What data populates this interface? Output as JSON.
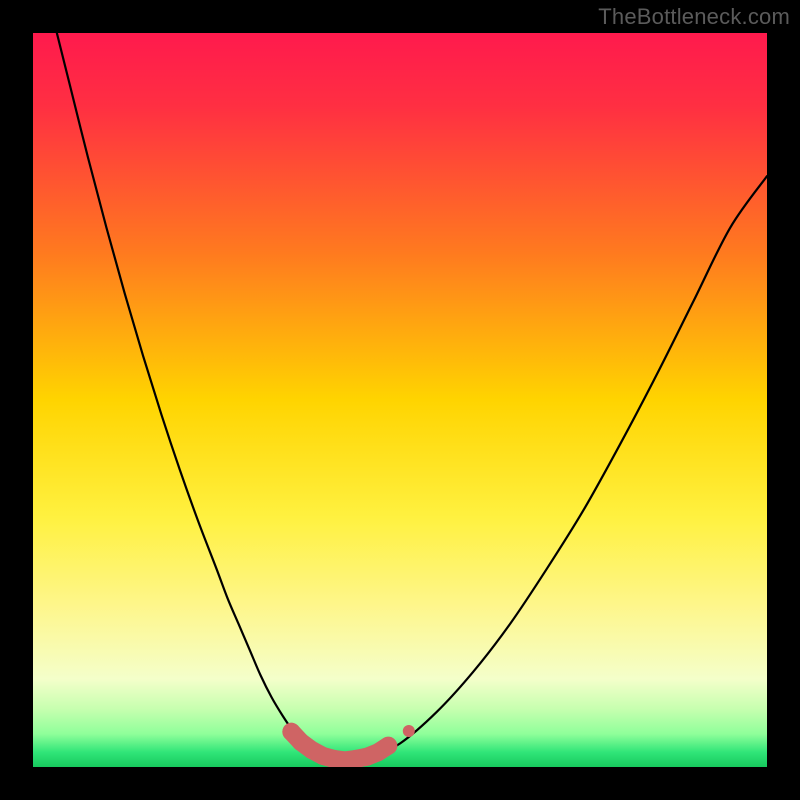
{
  "watermark": "TheBottleneck.com",
  "colors": {
    "bg": "#000000",
    "gradient_stops": [
      {
        "offset": 0.0,
        "color": "#ff1a4d"
      },
      {
        "offset": 0.1,
        "color": "#ff2f42"
      },
      {
        "offset": 0.3,
        "color": "#ff7a1f"
      },
      {
        "offset": 0.5,
        "color": "#ffd400"
      },
      {
        "offset": 0.66,
        "color": "#fff140"
      },
      {
        "offset": 0.78,
        "color": "#fef68b"
      },
      {
        "offset": 0.88,
        "color": "#f4ffca"
      },
      {
        "offset": 0.92,
        "color": "#c8ffb0"
      },
      {
        "offset": 0.955,
        "color": "#8fff9a"
      },
      {
        "offset": 0.98,
        "color": "#30e578"
      },
      {
        "offset": 1.0,
        "color": "#17c95e"
      }
    ],
    "curve": "#000000",
    "marker": "#cf6464"
  },
  "chart_data": {
    "type": "line",
    "title": "",
    "xlabel": "",
    "ylabel": "",
    "xlim": [
      0,
      100
    ],
    "ylim": [
      0,
      100
    ],
    "series": [
      {
        "name": "bottleneck-curve",
        "x": [
          3,
          5,
          7.5,
          10,
          12.5,
          15,
          17.5,
          20,
          22.5,
          25,
          26.5,
          28,
          29.5,
          31,
          32.5,
          34,
          35.5,
          37,
          40,
          43,
          46,
          50,
          55,
          60,
          65,
          70,
          75,
          80,
          85,
          90,
          95,
          100
        ],
        "y": [
          101,
          93,
          83,
          73.5,
          64.5,
          56,
          48,
          40.5,
          33.5,
          27,
          23,
          19.5,
          16,
          12.5,
          9.5,
          7,
          4.8,
          3,
          1.3,
          0.8,
          1.3,
          3.2,
          7.5,
          13,
          19.5,
          27,
          35,
          44,
          53.5,
          63.5,
          73.5,
          80.5
        ]
      }
    ],
    "markers": {
      "name": "highlight-markers",
      "series": "bottleneck-curve",
      "x": [
        35.2,
        36.5,
        38,
        39.5,
        41,
        42.5,
        44,
        45.5,
        47,
        48.4,
        51.2
      ],
      "y": [
        4.8,
        3.4,
        2.3,
        1.5,
        1.1,
        0.9,
        1.1,
        1.4,
        2.0,
        2.9,
        4.9
      ],
      "radius_px": 9,
      "end_radius_px": 6
    }
  }
}
